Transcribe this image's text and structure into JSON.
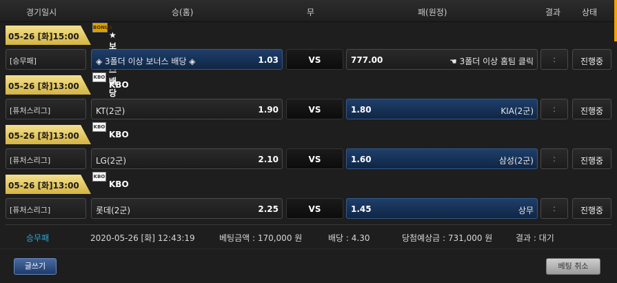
{
  "header": {
    "col_time": "경기일시",
    "col_home": "승(홈)",
    "col_draw": "무",
    "col_away": "패(원정)",
    "col_result": "결과",
    "col_status": "상태"
  },
  "groups": [
    {
      "date": "05-26 [화]15:00",
      "league_icon": "BONUS",
      "league": "★ 보너스배당 ★",
      "match": {
        "category": "[승무패]",
        "home_team": "◈ 3폴더 이상 보너스 배당 ◈",
        "home_odds": "1.03",
        "vs": "VS",
        "away_odds": "777.00",
        "away_team": "☚ 3폴더 이상 홈팀 클릭",
        "score": ":",
        "status": "진행중"
      }
    },
    {
      "date": "05-26 [화]13:00",
      "league_icon": "KBO",
      "league": "KBO",
      "match": {
        "category": "[퓨처스리그]",
        "home_team": "KT(2군)",
        "home_odds": "1.90",
        "vs": "VS",
        "away_odds": "1.80",
        "away_team": "KIA(2군)",
        "score": ":",
        "status": "진행중"
      }
    },
    {
      "date": "05-26 [화]13:00",
      "league_icon": "KBO",
      "league": "KBO",
      "match": {
        "category": "[퓨처스리그]",
        "home_team": "LG(2군)",
        "home_odds": "2.10",
        "vs": "VS",
        "away_odds": "1.60",
        "away_team": "삼성(2군)",
        "score": ":",
        "status": "진행중"
      }
    },
    {
      "date": "05-26 [화]13:00",
      "league_icon": "KBO",
      "league": "KBO",
      "match": {
        "category": "[퓨처스리그]",
        "home_team": "롯데(2군)",
        "home_odds": "2.25",
        "vs": "VS",
        "away_odds": "1.45",
        "away_team": "상무",
        "score": ":",
        "status": "진행중"
      }
    }
  ],
  "summary": {
    "bet_type": "승무패",
    "datetime": "2020-05-26 [화] 12:43:19",
    "bet_amount": "베팅금액 : 170,000 원",
    "odds": "배당 : 4.30",
    "expected_win": "당첨예상금 : 731,000 원",
    "result": "결과 : 대기"
  },
  "footer": {
    "write_label": "글쓰기",
    "cancel_label": "베팅 취소"
  },
  "colors": {
    "accent": "#f5a300",
    "selected_blue": "#1e3e6a",
    "date_gold": "#d4b442",
    "link_blue": "#2fa8d8"
  }
}
